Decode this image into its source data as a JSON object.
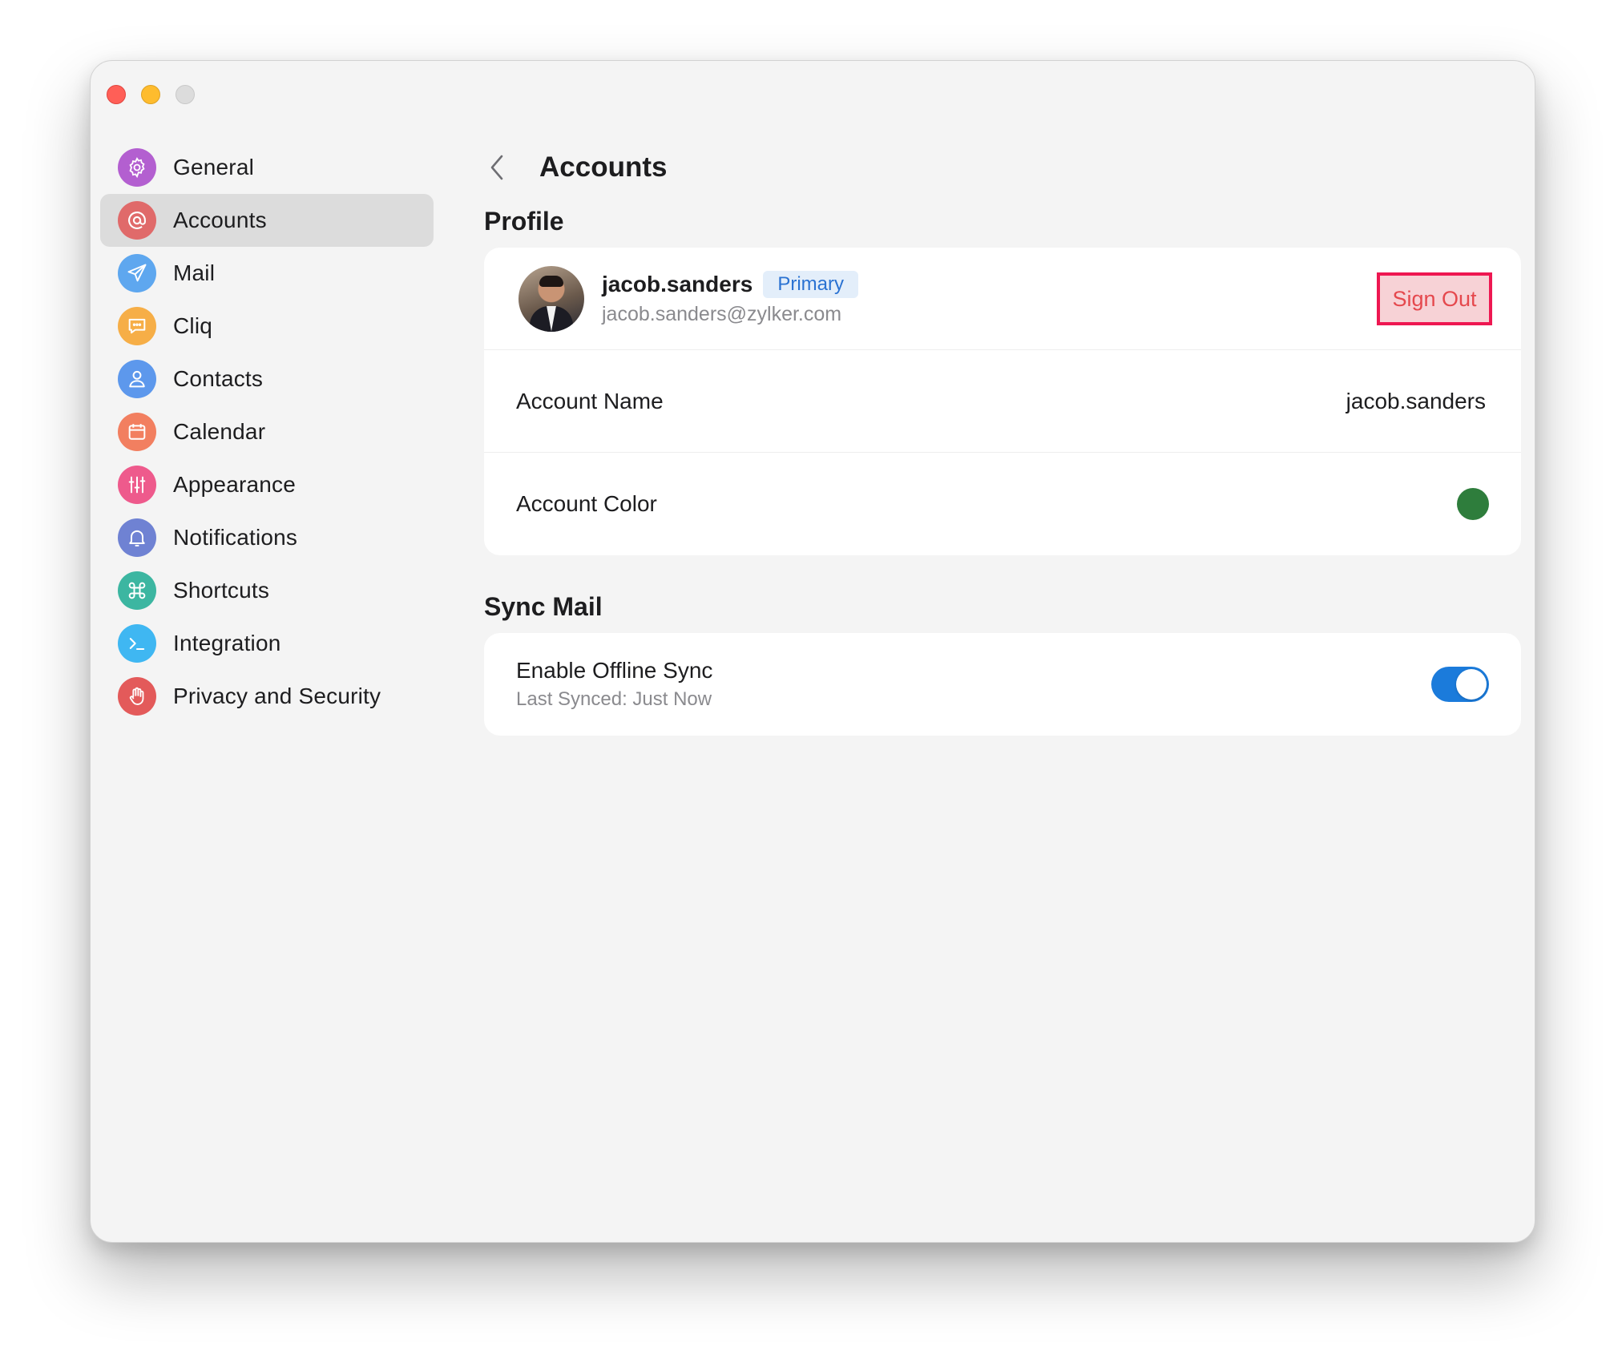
{
  "sidebar": {
    "items": [
      {
        "label": "General",
        "icon": "gear-icon",
        "color": "#b35fd0"
      },
      {
        "label": "Accounts",
        "icon": "at-icon",
        "color": "#e06a6a",
        "active": true
      },
      {
        "label": "Mail",
        "icon": "paper-plane-icon",
        "color": "#5ea7ef"
      },
      {
        "label": "Cliq",
        "icon": "chat-icon",
        "color": "#f6ae47"
      },
      {
        "label": "Contacts",
        "icon": "person-icon",
        "color": "#5d98ec"
      },
      {
        "label": "Calendar",
        "icon": "calendar-icon",
        "color": "#f27f60"
      },
      {
        "label": "Appearance",
        "icon": "sliders-icon",
        "color": "#ee5a8c"
      },
      {
        "label": "Notifications",
        "icon": "bell-icon",
        "color": "#6f82d3"
      },
      {
        "label": "Shortcuts",
        "icon": "command-icon",
        "color": "#3cb6a1"
      },
      {
        "label": "Integration",
        "icon": "terminal-icon",
        "color": "#3fb7f2"
      },
      {
        "label": "Privacy and Security",
        "icon": "hand-icon",
        "color": "#e35a5a"
      }
    ]
  },
  "header": {
    "title": "Accounts"
  },
  "profile": {
    "section_title": "Profile",
    "username": "jacob.sanders",
    "badge": "Primary",
    "email": "jacob.sanders@zylker.com",
    "sign_out_label": "Sign Out",
    "account_name_label": "Account Name",
    "account_name_value": "jacob.sanders",
    "account_color_label": "Account Color",
    "account_color": "#2e7d3c"
  },
  "sync": {
    "section_title": "Sync Mail",
    "label": "Enable Offline Sync",
    "status": "Last Synced: Just Now",
    "enabled": true
  }
}
